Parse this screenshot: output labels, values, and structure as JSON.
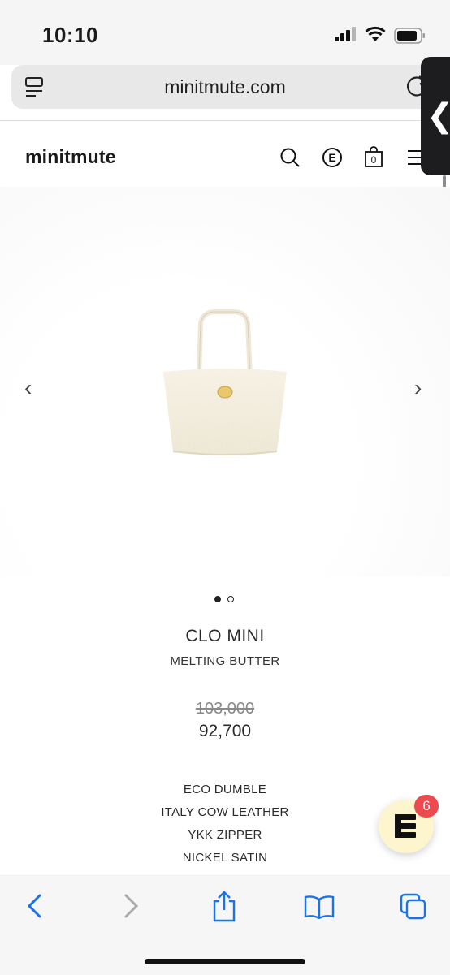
{
  "status_bar": {
    "time": "10:10"
  },
  "browser": {
    "url": "minitmute.com"
  },
  "site": {
    "logo": "minitmute",
    "cart_count": "0"
  },
  "product": {
    "name": "CLO MINI",
    "color": "MELTING BUTTER",
    "original_price": "103,000",
    "sale_price": "92,700",
    "features": [
      "ECO DUMBLE",
      "ITALY COW LEATHER",
      "YKK ZIPPER",
      "NICKEL SATIN"
    ],
    "image_count": 2,
    "active_image": 1
  },
  "chat": {
    "badge_count": "6",
    "letter": "E"
  },
  "icons": {
    "status": [
      "signal-icon",
      "wifi-icon",
      "battery-icon"
    ],
    "browser": [
      "tabs-menu-icon",
      "reload-icon"
    ],
    "header": [
      "search-icon",
      "e-badge-icon",
      "shopping-bag-icon",
      "menu-icon"
    ],
    "toolbar": [
      "back-icon",
      "forward-icon",
      "share-icon",
      "bookmarks-icon",
      "tabs-icon"
    ]
  }
}
